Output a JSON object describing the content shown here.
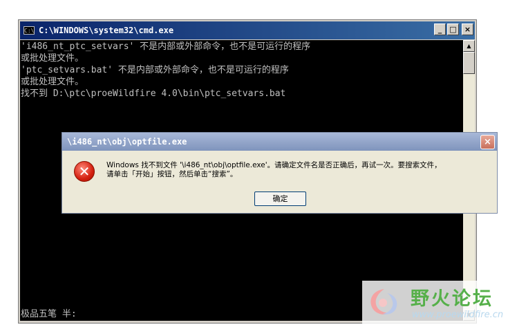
{
  "cmd_window": {
    "title": "C:\\WINDOWS\\system32\\cmd.exe",
    "icon_label": "C:\\",
    "controls": {
      "minimize": "_",
      "maximize": "□",
      "close": "×"
    },
    "console_lines": [
      "'i486_nt_ptc_setvars' 不是内部或外部命令，也不是可运行的程序",
      "或批处理文件。",
      "'ptc_setvars.bat' 不是内部或外部命令，也不是可运行的程序",
      "或批处理文件。",
      "找不到 D:\\ptc\\proeWildfire 4.0\\bin\\ptc_setvars.bat"
    ],
    "ime_status": "极品五笔 半:",
    "scroll_up": "▲",
    "scroll_down": "▼"
  },
  "error_dialog": {
    "title": "\\i486_nt\\obj\\optfile.exe",
    "close": "×",
    "icon": "error-icon",
    "icon_glyph": "✕",
    "message_lines": [
      "Windows 找不到文件 '\\i486_nt\\obj\\optfile.exe'。请确定文件名是否正确后，再试一次。要搜索文件，",
      "请单击「开始」按钮，然后单击“搜索”。"
    ],
    "ok_label": "确定"
  },
  "watermark": {
    "text_cn": "野火论坛",
    "url": "www.proewildfire.cn"
  },
  "colors": {
    "cmd_titlebar": "#0a246a",
    "console_bg": "#000000",
    "console_text": "#c0c0c0",
    "dialog_titlebar": "#8a9cc4",
    "watermark_green": "#56b04a"
  }
}
